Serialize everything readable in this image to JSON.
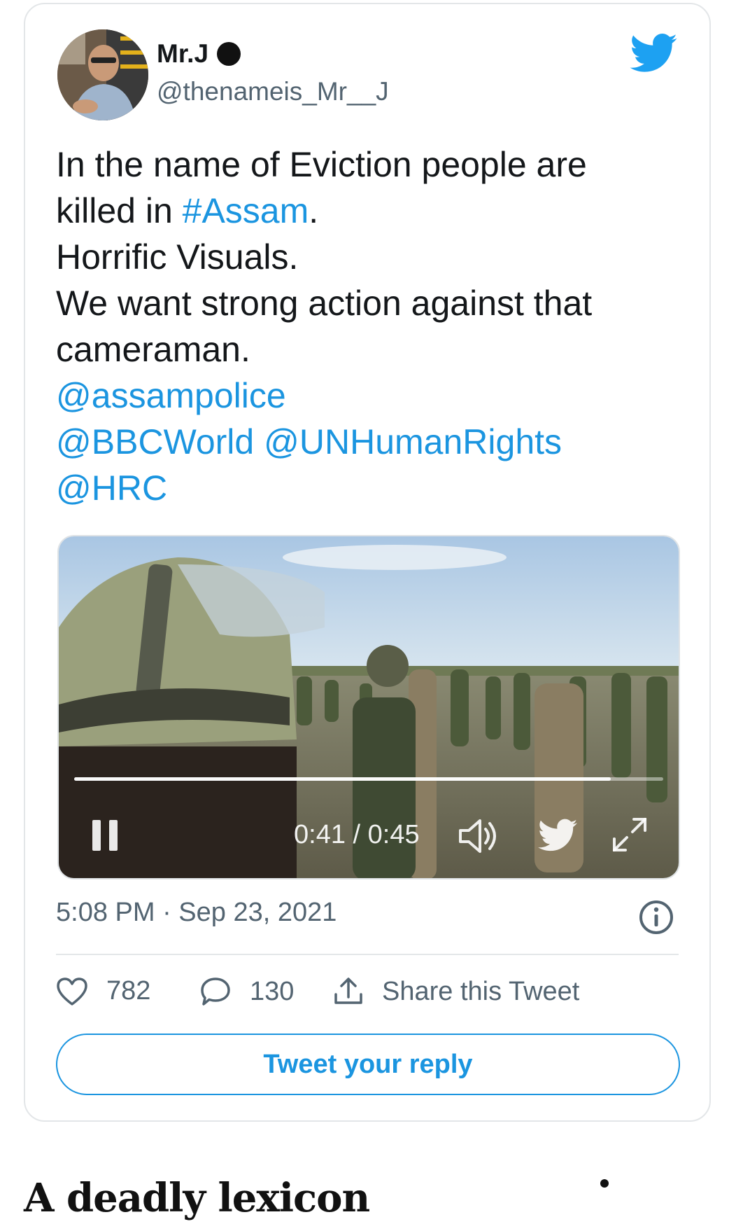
{
  "tweet": {
    "display_name": "Mr.J",
    "handle": "@thenameis_Mr__J",
    "text_lines": [
      [
        {
          "t": "In the name of Eviction people are",
          "link": false
        }
      ],
      [
        {
          "t": "killed in ",
          "link": false
        },
        {
          "t": "#Assam",
          "link": true
        },
        {
          "t": ".",
          "link": false
        }
      ],
      [
        {
          "t": "Horrific Visuals.",
          "link": false
        }
      ],
      [
        {
          "t": "We want strong action against that",
          "link": false
        }
      ],
      [
        {
          "t": "cameraman.",
          "link": false
        }
      ],
      [
        {
          "t": "@assampolice",
          "link": true
        }
      ],
      [
        {
          "t": "@BBCWorld",
          "link": true
        },
        {
          "t": " ",
          "link": false
        },
        {
          "t": "@UNHumanRights",
          "link": true
        }
      ],
      [
        {
          "t": "@HRC",
          "link": true
        }
      ]
    ],
    "timestamp": "5:08 PM · Sep 23, 2021",
    "likes": "782",
    "replies": "130",
    "share_label": "Share this Tweet",
    "reply_button_label": "Tweet your reply"
  },
  "video": {
    "time_display": "0:41 / 0:45",
    "progress": 0.911
  },
  "article": {
    "heading": "A deadly lexicon"
  },
  "colors": {
    "link": "#1b95e0",
    "text": "#14171a",
    "secondary": "#536471",
    "border": "#e3e6e8"
  },
  "icons": {
    "brand": "twitter-bird-icon",
    "like": "heart-icon",
    "reply": "speech-bubble-icon",
    "share": "share-upload-icon",
    "info": "info-icon",
    "pause": "pause-icon",
    "volume": "volume-icon",
    "fullscreen": "fullscreen-icon"
  }
}
